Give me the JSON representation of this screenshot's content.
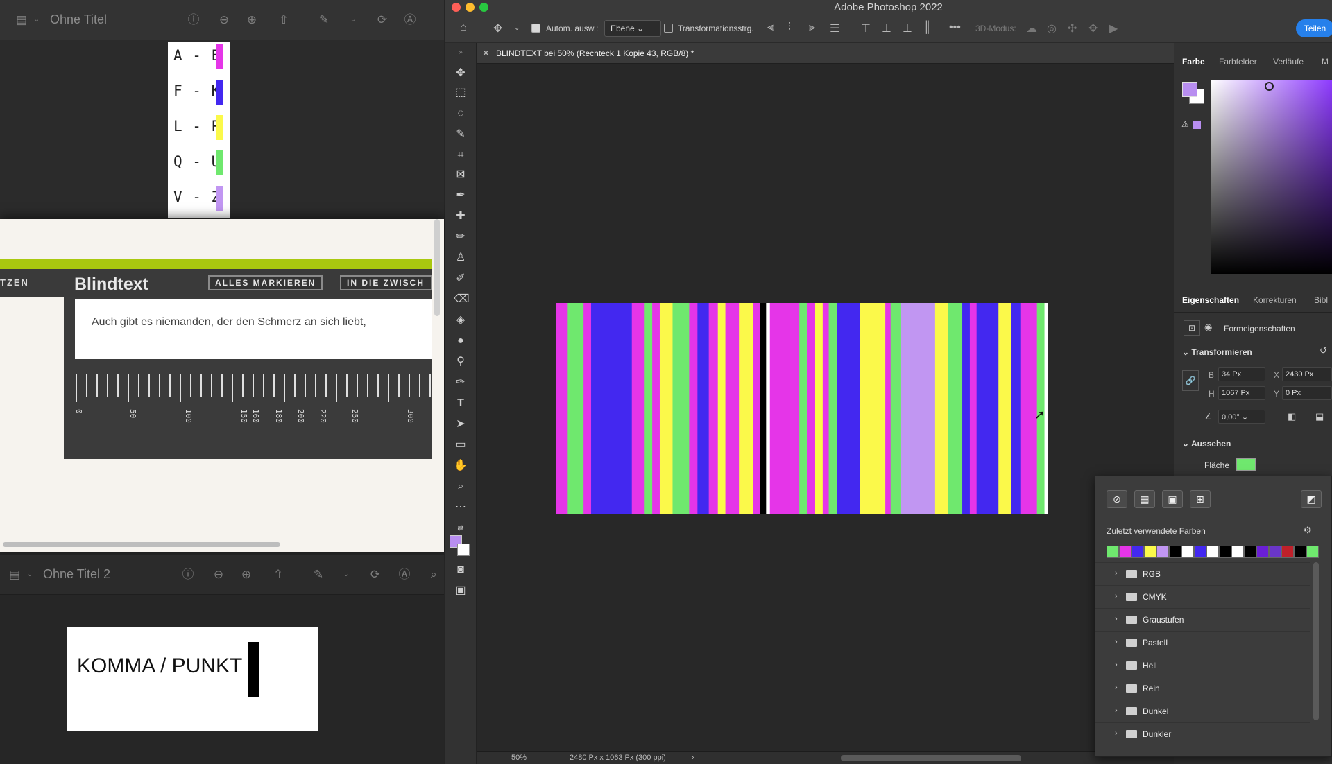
{
  "left_windows": {
    "window1": {
      "title": "Ohne Titel",
      "legend": [
        {
          "label": "A - E",
          "color": "#e535e8"
        },
        {
          "label": "F - K",
          "color": "#4328f0"
        },
        {
          "label": "L - P",
          "color": "#fbf94a"
        },
        {
          "label": "Q - U",
          "color": "#6fe86e"
        },
        {
          "label": "V - Z",
          "color": "#c196f2"
        }
      ]
    },
    "document": {
      "cut_label": "TZEN",
      "title": "Blindtext",
      "button1": "ALLES MARKIEREN",
      "button2": "IN DIE ZWISCH",
      "body_text": "Auch gibt es niemanden, der den Schmerz an sich liebt,",
      "ruler_labels": [
        "0",
        "50",
        "100",
        "150",
        "160",
        "180",
        "200",
        "220",
        "250",
        "300"
      ]
    },
    "window2": {
      "title": "Ohne Titel 2",
      "card_text": "KOMMA / PUNKT"
    }
  },
  "photoshop": {
    "app_title": "Adobe Photoshop 2022",
    "options_bar": {
      "auto_select_label": "Autom. ausw.:",
      "auto_select_value": "Ebene",
      "transform_label": "Transformationsstrg.",
      "mode3d_label": "3D-Modus:",
      "share_label": "Teilen"
    },
    "doc_tab": "BLINDTEXT bei 50% (Rechteck 1 Kopie 43, RGB/8) *",
    "status": {
      "zoom": "50%",
      "doc_info": "2480 Px x 1063 Px (300 ppi)"
    },
    "color_panel": {
      "tabs": [
        "Farbe",
        "Farbfelder",
        "Verläufe",
        "M"
      ],
      "foreground": "#b88ef0"
    },
    "properties_panel": {
      "tabs": [
        "Eigenschaften",
        "Korrekturen",
        "Bibl"
      ],
      "shape_props_label": "Formeigenschaften",
      "transform_header": "Transformieren",
      "w_label": "B",
      "w_value": "34 Px",
      "x_label": "X",
      "x_value": "2430 Px",
      "h_label": "H",
      "h_value": "1067 Px",
      "y_label": "Y",
      "y_value": "0 Px",
      "angle_value": "0,00°",
      "appearance_header": "Aussehen",
      "fill_label": "Fläche",
      "fill_color": "#6fe86e"
    },
    "swatch_popup": {
      "recent_label": "Zuletzt verwendete Farben",
      "recent_colors": [
        "#6fe86e",
        "#e535e8",
        "#4328f0",
        "#fbf94a",
        "#c196f2",
        "#000000",
        "#ffffff",
        "#4328f0",
        "#ffffff",
        "#000000",
        "#ffffff",
        "#000000",
        "#6a1fd6",
        "#6a36c8",
        "#c0202a",
        "#000000",
        "#6fe86e"
      ],
      "folders": [
        "RGB",
        "CMYK",
        "Graustufen",
        "Pastell",
        "Hell",
        "Rein",
        "Dunkel",
        "Dunkler"
      ]
    },
    "canvas_stripes": [
      {
        "w": 15,
        "c": "#e535e8"
      },
      {
        "w": 21,
        "c": "#6fe86e"
      },
      {
        "w": 10,
        "c": "#e535e8"
      },
      {
        "w": 54,
        "c": "#4328f0"
      },
      {
        "w": 17,
        "c": "#e535e8"
      },
      {
        "w": 10,
        "c": "#6fe86e"
      },
      {
        "w": 10,
        "c": "#e535e8"
      },
      {
        "w": 17,
        "c": "#fbf94a"
      },
      {
        "w": 22,
        "c": "#6fe86e"
      },
      {
        "w": 11,
        "c": "#e535e8"
      },
      {
        "w": 15,
        "c": "#4328f0"
      },
      {
        "w": 12,
        "c": "#e535e8"
      },
      {
        "w": 10,
        "c": "#fbf94a"
      },
      {
        "w": 18,
        "c": "#e535e8"
      },
      {
        "w": 19,
        "c": "#fbf94a"
      },
      {
        "w": 9,
        "c": "#e535e8"
      },
      {
        "w": 8,
        "c": "#000000"
      },
      {
        "w": 5,
        "c": "#ffffff"
      },
      {
        "w": 39,
        "c": "#e535e8"
      },
      {
        "w": 10,
        "c": "#6fe86e"
      },
      {
        "w": 11,
        "c": "#e535e8"
      },
      {
        "w": 10,
        "c": "#fbf94a"
      },
      {
        "w": 8,
        "c": "#e535e8"
      },
      {
        "w": 11,
        "c": "#6fe86e"
      },
      {
        "w": 30,
        "c": "#4328f0"
      },
      {
        "w": 34,
        "c": "#fbf94a"
      },
      {
        "w": 7,
        "c": "#e535e8"
      },
      {
        "w": 14,
        "c": "#6fe86e"
      },
      {
        "w": 45,
        "c": "#c196f2"
      },
      {
        "w": 17,
        "c": "#fbf94a"
      },
      {
        "w": 19,
        "c": "#6fe86e"
      },
      {
        "w": 10,
        "c": "#4328f0"
      },
      {
        "w": 9,
        "c": "#e535e8"
      },
      {
        "w": 29,
        "c": "#4328f0"
      },
      {
        "w": 17,
        "c": "#fbf94a"
      },
      {
        "w": 12,
        "c": "#4328f0"
      },
      {
        "w": 22,
        "c": "#e535e8"
      },
      {
        "w": 10,
        "c": "#6fe86e"
      },
      {
        "w": 5,
        "c": "#ffffff"
      }
    ]
  }
}
